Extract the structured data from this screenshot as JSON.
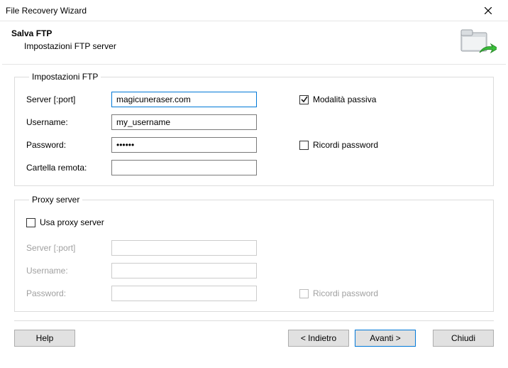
{
  "window": {
    "title": "File Recovery Wizard"
  },
  "header": {
    "title": "Salva FTP",
    "subtitle": "Impostazioni FTP server"
  },
  "ftp": {
    "legend": "Impostazioni FTP",
    "server_label": "Server [:port]",
    "server_value": "magicuneraser.com",
    "username_label": "Username:",
    "username_value": "my_username",
    "password_label": "Password:",
    "password_value": "••••••",
    "remote_folder_label": "Cartella remota:",
    "remote_folder_value": "",
    "passive_label": "Modalità passiva",
    "passive_checked": true,
    "remember_label": "Ricordi password",
    "remember_checked": false
  },
  "proxy": {
    "legend": "Proxy server",
    "use_proxy_label": "Usa proxy server",
    "use_proxy_checked": false,
    "server_label": "Server [:port]",
    "server_value": "",
    "username_label": "Username:",
    "username_value": "",
    "password_label": "Password:",
    "password_value": "",
    "remember_label": "Ricordi password",
    "remember_checked": false
  },
  "buttons": {
    "help": "Help",
    "back": "< Indietro",
    "next": "Avanti >",
    "close": "Chiudi"
  }
}
